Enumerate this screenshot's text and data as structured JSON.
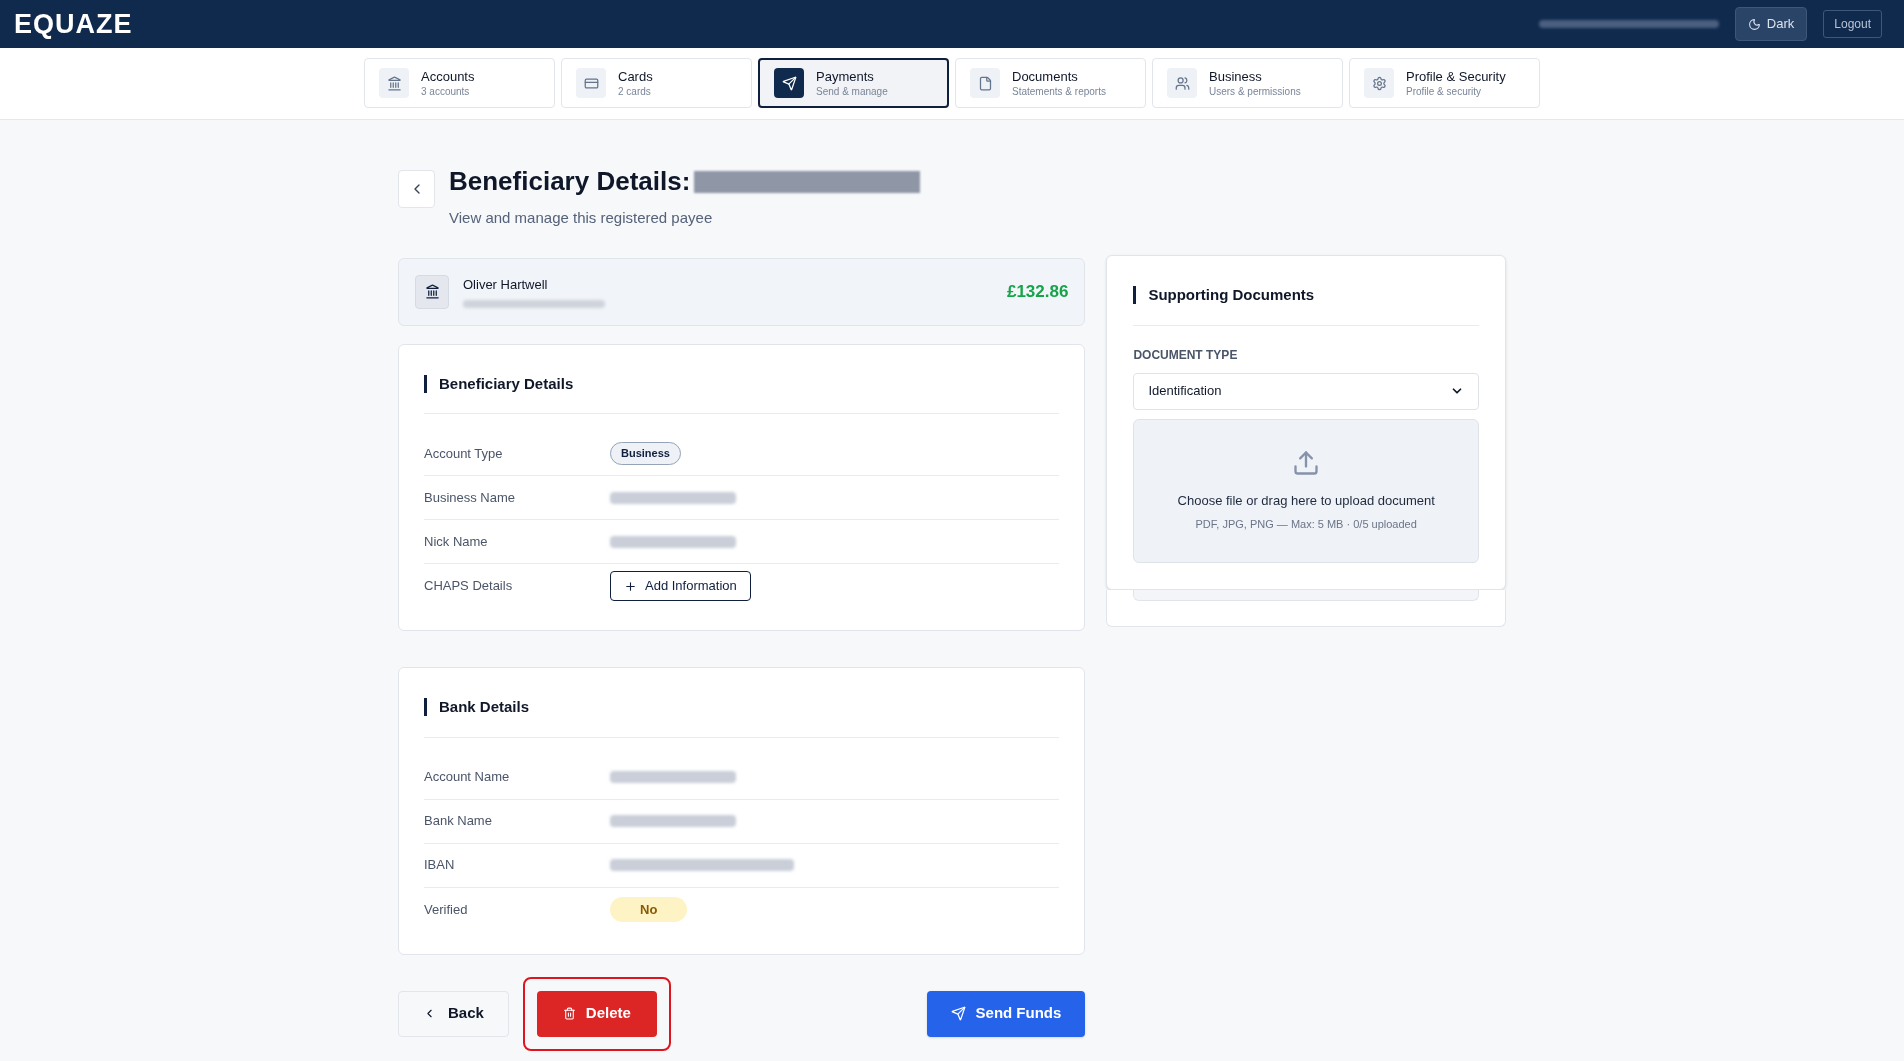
{
  "header": {
    "logo": "EQUAZE",
    "theme_button": "Dark",
    "logout_button": "Logout"
  },
  "tabs": [
    {
      "kind": "bank",
      "title": "Accounts",
      "subtitle": "3 accounts",
      "selected": false
    },
    {
      "kind": "card",
      "title": "Cards",
      "subtitle": "2 cards",
      "selected": false
    },
    {
      "kind": "send",
      "title": "Payments",
      "subtitle": "Send & manage",
      "selected": true
    },
    {
      "kind": "file",
      "title": "Documents",
      "subtitle": "Statements & reports",
      "selected": false
    },
    {
      "kind": "users",
      "title": "Business",
      "subtitle": "Users & permissions",
      "selected": false
    },
    {
      "kind": "gear",
      "title": "Profile & Security",
      "subtitle": "Profile & security",
      "selected": false
    }
  ],
  "page": {
    "title": "Beneficiary Details:",
    "subtitle": "View and manage this registered payee"
  },
  "summary": {
    "name": "Oliver Hartwell",
    "amount": "£132.86"
  },
  "sections": [
    {
      "title": "Beneficiary Details",
      "rows": [
        {
          "label": "Account Type",
          "kind": "badge",
          "value": "Business"
        },
        {
          "label": "Business Name",
          "kind": "redacted"
        },
        {
          "label": "Nick Name",
          "kind": "redacted"
        },
        {
          "label": "CHAPS Details",
          "kind": "button",
          "value": "Add Information"
        }
      ]
    },
    {
      "title": "Bank Details",
      "rows": [
        {
          "label": "Account Name",
          "kind": "redacted"
        },
        {
          "label": "Bank Name",
          "kind": "redacted"
        },
        {
          "label": "IBAN",
          "kind": "redacted_long"
        },
        {
          "label": "Verified",
          "kind": "status",
          "value": "No"
        }
      ]
    }
  ],
  "documents": {
    "title": "Supporting Documents",
    "field_label": "DOCUMENT TYPE",
    "selected_type": "Identification",
    "upload_text": "Choose file or drag here to upload document",
    "upload_hint": "PDF, JPG, PNG — Max: 5 MB · 0/5 uploaded"
  },
  "actions": {
    "back": "Back",
    "delete": "Delete",
    "delete_highlighted": true,
    "send": "Send Funds"
  }
}
